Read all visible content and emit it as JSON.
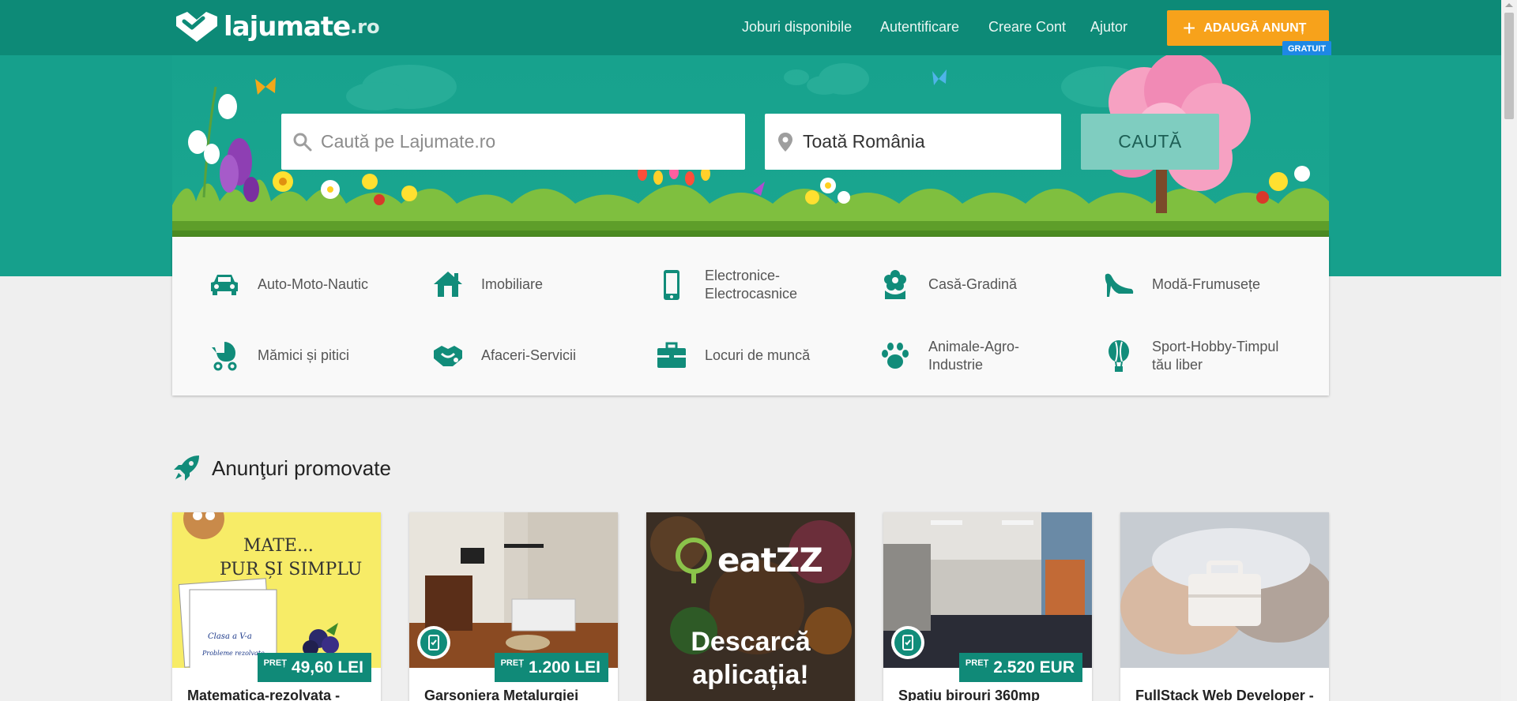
{
  "brand": {
    "name": "lajumate",
    "tld": ".ro"
  },
  "nav": {
    "items": [
      {
        "label": "Joburi disponibile"
      },
      {
        "label": "Autentificare"
      },
      {
        "label": "Creare Cont"
      },
      {
        "label": "Ajutor"
      }
    ],
    "add_button": "ADAUGĂ ANUNȚ",
    "badge": "GRATUIT"
  },
  "search": {
    "placeholder": "Caută pe Lajumate.ro",
    "location": "Toată România",
    "button": "CAUTĂ"
  },
  "categories": [
    {
      "label": "Auto-Moto-Nautic",
      "icon": "car-icon"
    },
    {
      "label": "Imobiliare",
      "icon": "house-icon"
    },
    {
      "label": "Electronice-Electrocasnice",
      "icon": "phone-icon"
    },
    {
      "label": "Casă-Gradină",
      "icon": "flower-icon"
    },
    {
      "label": "Modă-Frumusețe",
      "icon": "high-heel-icon"
    },
    {
      "label": "Mămici și pitici",
      "icon": "stroller-icon"
    },
    {
      "label": "Afaceri-Servicii",
      "icon": "handshake-icon"
    },
    {
      "label": "Locuri de muncă",
      "icon": "briefcase-icon"
    },
    {
      "label": "Animale-Agro-Industrie",
      "icon": "paw-icon"
    },
    {
      "label": "Sport-Hobby-Timpul tău liber",
      "icon": "balloon-icon"
    }
  ],
  "promoted": {
    "title": "Anunţuri promovate",
    "cards": [
      {
        "title": "Matematica-rezolvata - ",
        "price_label": "PREȚ",
        "price": "49,60 LEI",
        "image_text_1": "MATE...",
        "image_text_2": "PUR ȘI SIMPLU",
        "image_text_3": "Clasa a V-a",
        "image_text_4": "Probleme rezolvate"
      },
      {
        "title": "Garsoniera Metalurgiei ",
        "price_label": "PREȚ",
        "price": "1.200 LEI"
      },
      {
        "title": "",
        "price_label": "",
        "price": "",
        "image_text_1": "eatZZ",
        "image_text_2": "Descarcă",
        "image_text_3": "aplicația!"
      },
      {
        "title": "Spatiu birouri 360mp ",
        "price_label": "PREȚ",
        "price": "2.520 EUR"
      },
      {
        "title": "FullStack Web Developer - ",
        "price_label": "",
        "price": ""
      }
    ]
  },
  "colors": {
    "primary": "#0d8a77",
    "hero": "#16a08c",
    "accent": "#f7a21b",
    "badge": "#1e88e5",
    "search_button": "#7fcdc0"
  }
}
